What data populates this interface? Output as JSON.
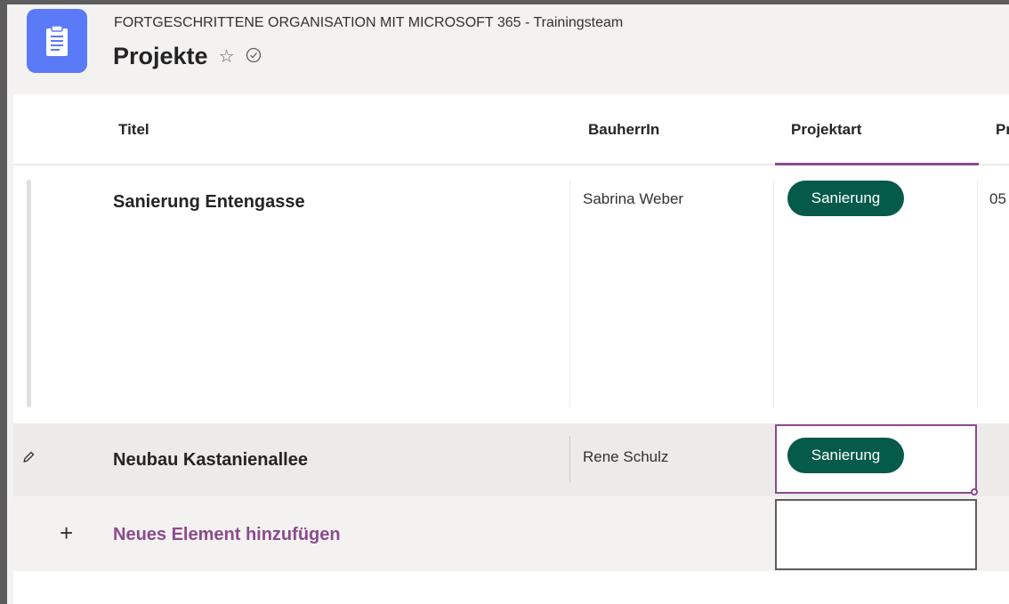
{
  "header": {
    "breadcrumb": "FORTGESCHRITTENE ORGANISATION MIT MICROSOFT 365 - Trainingsteam",
    "title": "Projekte",
    "favorite_icon": "star-outline-icon",
    "status_icon": "check-circle-icon"
  },
  "columns": [
    {
      "label": "Titel"
    },
    {
      "label": "BauherrIn"
    },
    {
      "label": "Projektart"
    },
    {
      "label": "Pr"
    }
  ],
  "rows": [
    {
      "title": "Sanierung Entengasse",
      "bauherrin": "Sabrina Weber",
      "projektart": "Sanierung",
      "next_col": "05"
    },
    {
      "title": "Neubau Kastanienallee",
      "bauherrin": "Rene Schulz",
      "projektart": "Sanierung",
      "edit_icon": "pencil-icon"
    }
  ],
  "add_row": {
    "label": "Neues Element hinzufügen",
    "icon": "plus-icon"
  },
  "colors": {
    "accent": "#8d4a8d",
    "pill_bg": "#055a4a",
    "app_icon": "#5a7af7"
  }
}
